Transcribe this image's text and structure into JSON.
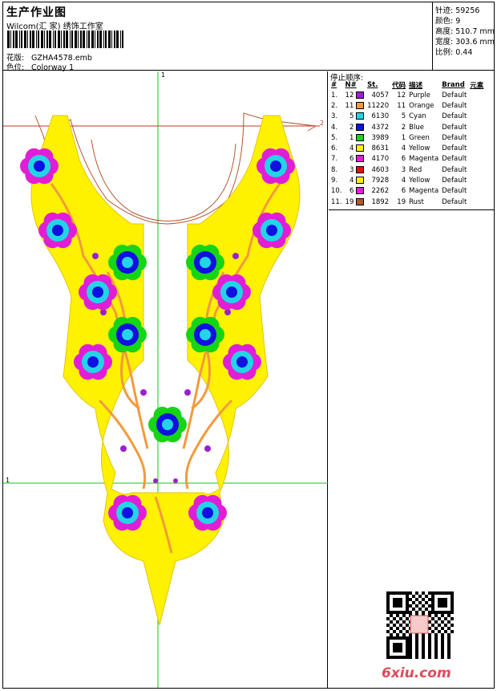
{
  "header": {
    "title": "生产作业图",
    "subtitle": "Wilcom(汇 家) 绣饰工作室",
    "design_label": "花版:",
    "design_value": "GZHA4578.emb",
    "colorway_label": "色位:",
    "colorway_value": "Colorway 1"
  },
  "stats": {
    "stitches": "针迹: 59256",
    "colors": "颜色: 9",
    "height": "高度: 510.7 mm",
    "width": "宽度: 303.6 mm",
    "scale": "比例: 0.44"
  },
  "panel": {
    "title": "停止顺序:",
    "columns": [
      "#",
      "N#",
      "St.",
      "代码",
      "描述",
      "Brand",
      "元素"
    ],
    "rows": [
      {
        "idx": "1.",
        "n": "12",
        "color": "#9b1fd0",
        "st": "4057",
        "code": "12",
        "desc": "Purple",
        "brand": "Default"
      },
      {
        "idx": "2.",
        "n": "11",
        "color": "#f39a3c",
        "st": "11220",
        "code": "11",
        "desc": "Orange",
        "brand": "Default"
      },
      {
        "idx": "3.",
        "n": "5",
        "color": "#22d4e6",
        "st": "6130",
        "code": "5",
        "desc": "Cyan",
        "brand": "Default"
      },
      {
        "idx": "4.",
        "n": "2",
        "color": "#1010e0",
        "st": "4372",
        "code": "2",
        "desc": "Blue",
        "brand": "Default"
      },
      {
        "idx": "5.",
        "n": "1",
        "color": "#16d416",
        "st": "3989",
        "code": "1",
        "desc": "Green",
        "brand": "Default"
      },
      {
        "idx": "6.",
        "n": "4",
        "color": "#fff200",
        "st": "8631",
        "code": "4",
        "desc": "Yellow",
        "brand": "Default"
      },
      {
        "idx": "7.",
        "n": "6",
        "color": "#e01ed8",
        "st": "4170",
        "code": "6",
        "desc": "Magenta",
        "brand": "Default"
      },
      {
        "idx": "8.",
        "n": "3",
        "color": "#e01010",
        "st": "4603",
        "code": "3",
        "desc": "Red",
        "brand": "Default"
      },
      {
        "idx": "9.",
        "n": "4",
        "color": "#fff200",
        "st": "7928",
        "code": "4",
        "desc": "Yellow",
        "brand": "Default"
      },
      {
        "idx": "10.",
        "n": "6",
        "color": "#e01ed8",
        "st": "2262",
        "code": "6",
        "desc": "Magenta",
        "brand": "Default"
      },
      {
        "idx": "11.",
        "n": "19",
        "color": "#b5552e",
        "st": "1892",
        "code": "19",
        "desc": "Rust",
        "brand": "Default"
      }
    ]
  },
  "guides": {
    "v1": "1",
    "h1": "1",
    "h2": "2"
  },
  "watermark": "6xiu.com"
}
